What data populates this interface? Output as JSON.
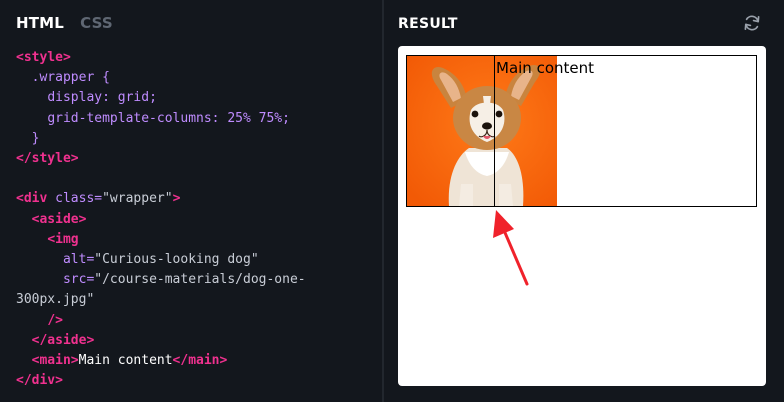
{
  "editor": {
    "tabs": [
      {
        "label": "HTML",
        "active": true
      },
      {
        "label": "CSS",
        "active": false
      }
    ],
    "code": {
      "l1": {
        "tag": "<style>"
      },
      "l2": {
        "selector": ".wrapper {"
      },
      "l3": {
        "prop": "display:",
        "value": " grid;"
      },
      "l4": {
        "prop": "grid-template-columns:",
        "value": " 25% 75%;"
      },
      "l5": {
        "close": "}"
      },
      "l6": {
        "tag": "</style>"
      },
      "l8": {
        "tag_open": "<div",
        "attr": " class=",
        "str": "\"wrapper\"",
        "tag_close": ">"
      },
      "l9": {
        "tag": "<aside>"
      },
      "l10": {
        "tag": "<img"
      },
      "l11": {
        "attr": "alt=",
        "str": "\"Curious-looking dog\""
      },
      "l12": {
        "attr": "src=",
        "str": "\"/course-materials/dog-one-"
      },
      "l13": {
        "str": "300px.jpg\""
      },
      "l14": {
        "tag": "/>"
      },
      "l15": {
        "tag": "</aside>"
      },
      "l16": {
        "tag_open": "<main>",
        "text": "Main content",
        "tag_close": "</main>"
      },
      "l17": {
        "tag": "</div>"
      }
    }
  },
  "result": {
    "title": "RESULT",
    "refresh_icon": "refresh-icon",
    "main_text": "Main content",
    "image_alt": "Curious-looking dog",
    "annotation_color": "#f0222b"
  },
  "colors": {
    "background": "#13171d",
    "tag": "#f0318f",
    "property": "#bf8cff",
    "dog_background": "#ff6a0c"
  }
}
